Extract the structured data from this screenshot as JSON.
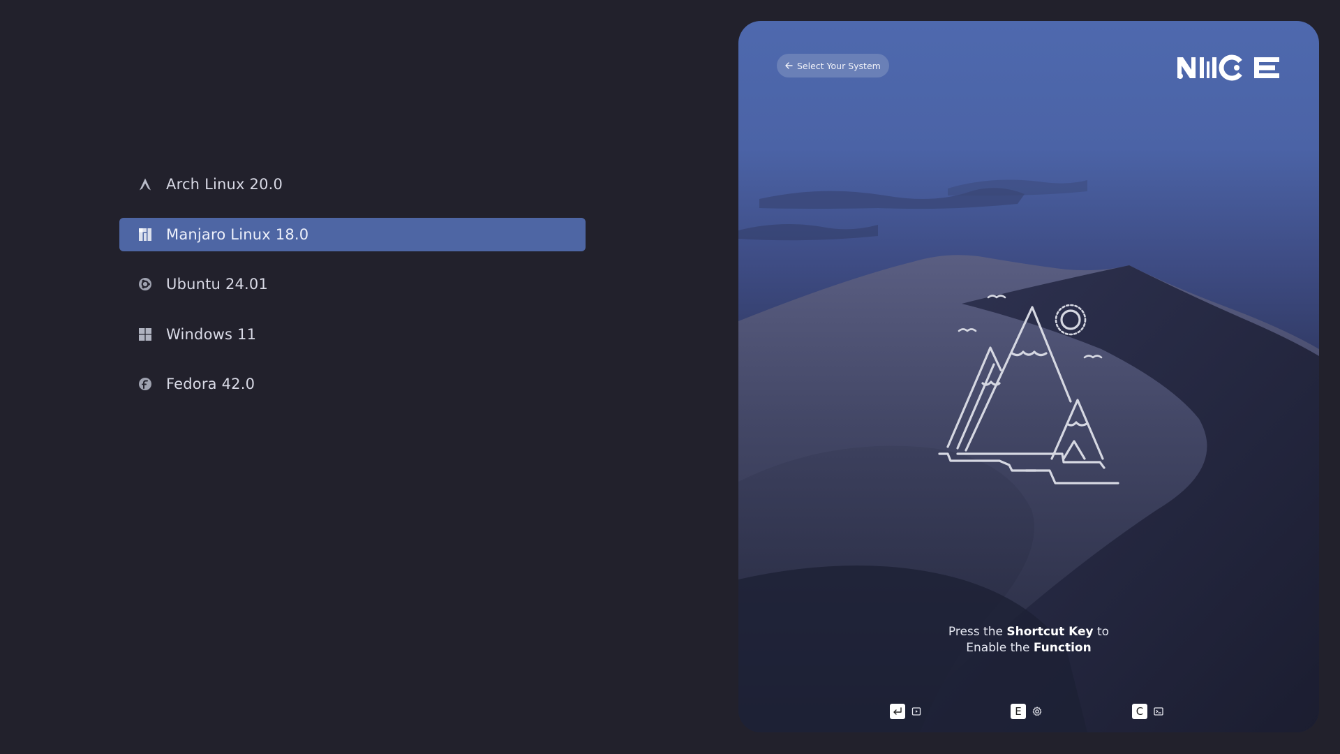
{
  "menu": {
    "items": [
      {
        "label": "Arch Linux 20.0",
        "icon": "arch-logo-icon",
        "selected": false
      },
      {
        "label": "Manjaro Linux 18.0",
        "icon": "manjaro-logo-icon",
        "selected": true
      },
      {
        "label": "Ubuntu 24.01",
        "icon": "ubuntu-logo-icon",
        "selected": false
      },
      {
        "label": "Windows 11",
        "icon": "windows-logo-icon",
        "selected": false
      },
      {
        "label": "Fedora 42.0",
        "icon": "fedora-logo-icon",
        "selected": false
      }
    ]
  },
  "panel": {
    "back_label": "Select Your System",
    "back_icon": "arrow-left-icon",
    "logo_text": "NICE",
    "hint": {
      "line1_pre": "Press the ",
      "line1_bold": "Shortcut Key",
      "line1_post": " to",
      "line2_pre": "Enable the ",
      "line2_bold": "Function"
    },
    "shortcuts": [
      {
        "key": "↵",
        "key_icon": "enter-key-icon",
        "function_icon": "boot-icon"
      },
      {
        "key": "E",
        "key_icon": "e-key",
        "function_icon": "settings-gear-icon"
      },
      {
        "key": "C",
        "key_icon": "c-key",
        "function_icon": "terminal-icon"
      }
    ]
  },
  "colors": {
    "background": "#22212c",
    "selected": "#4e66a4",
    "text": "#d9dae6"
  }
}
